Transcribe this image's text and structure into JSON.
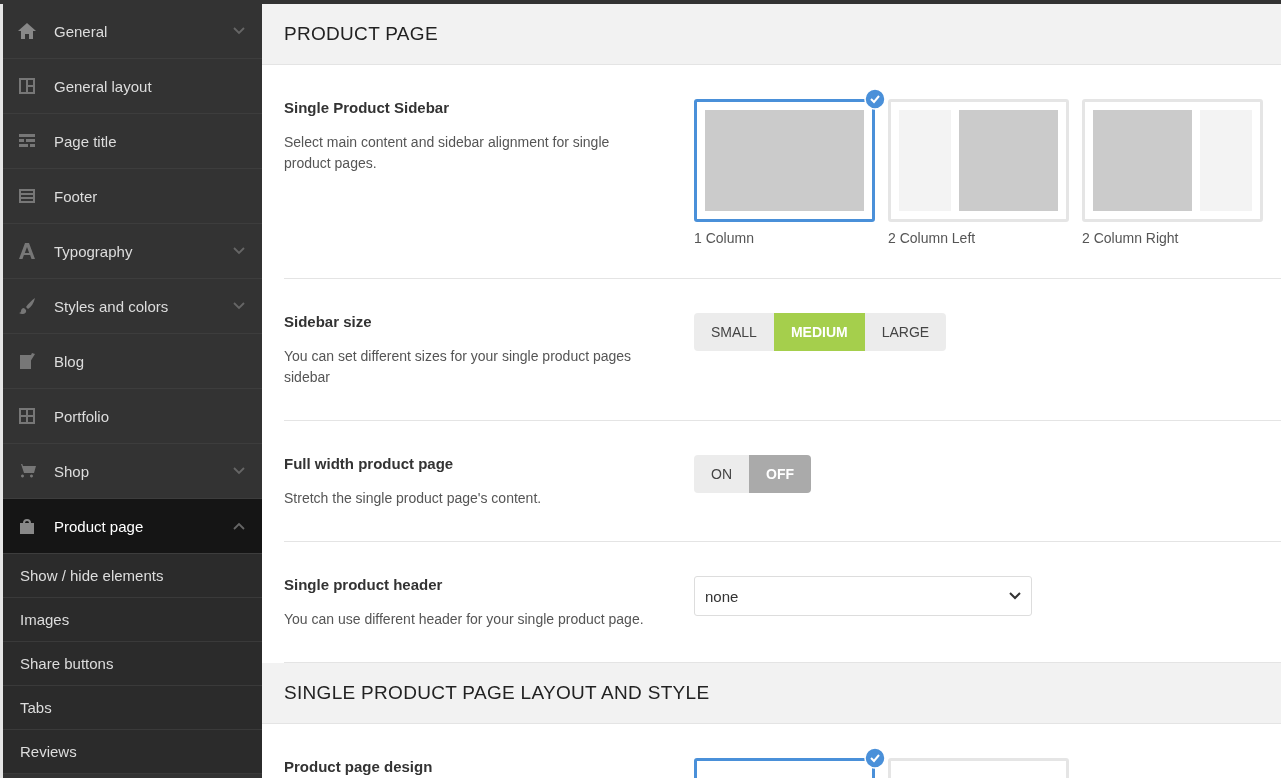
{
  "sidebar": {
    "items": [
      {
        "label": "General",
        "kind": "group",
        "expanded": false,
        "selected": false
      },
      {
        "label": "General layout",
        "kind": "link",
        "selected": false
      },
      {
        "label": "Page title",
        "kind": "link",
        "selected": false
      },
      {
        "label": "Footer",
        "kind": "link",
        "selected": false
      },
      {
        "label": "Typography",
        "kind": "group",
        "expanded": false,
        "selected": false
      },
      {
        "label": "Styles and colors",
        "kind": "group",
        "expanded": false,
        "selected": false
      },
      {
        "label": "Blog",
        "kind": "link",
        "selected": false
      },
      {
        "label": "Portfolio",
        "kind": "link",
        "selected": false
      },
      {
        "label": "Shop",
        "kind": "group",
        "expanded": false,
        "selected": false
      },
      {
        "label": "Product page",
        "kind": "group",
        "expanded": true,
        "selected": true,
        "children": [
          {
            "label": "Show / hide elements",
            "selected": false
          },
          {
            "label": "Images",
            "selected": false
          },
          {
            "label": "Share buttons",
            "selected": false
          },
          {
            "label": "Tabs",
            "selected": false
          },
          {
            "label": "Reviews",
            "selected": false
          }
        ]
      }
    ]
  },
  "sections": [
    {
      "title": "PRODUCT PAGE",
      "settings": [
        {
          "kind": "layout",
          "label": "Single Product Sidebar",
          "description": "Select main content and sidebar alignment for single product pages.",
          "options": [
            {
              "label": "1 Column",
              "kind": "full",
              "selected": true
            },
            {
              "label": "2 Column Left",
              "kind": "left",
              "selected": false
            },
            {
              "label": "2 Column Right",
              "kind": "right",
              "selected": false
            }
          ]
        },
        {
          "kind": "segmented",
          "label": "Sidebar size",
          "description": "You can set different sizes for your single product pages sidebar",
          "options": [
            {
              "label": "SMALL",
              "selected": false
            },
            {
              "label": "MEDIUM",
              "selected": true
            },
            {
              "label": "LARGE",
              "selected": false
            }
          ]
        },
        {
          "kind": "toggle",
          "label": "Full width product page",
          "description": "Stretch the single product page's content.",
          "options": [
            {
              "label": "ON",
              "selected": false
            },
            {
              "label": "OFF",
              "selected": true
            }
          ]
        },
        {
          "kind": "select",
          "label": "Single product header",
          "description": "You can use different header for your single product page.",
          "value": "none"
        }
      ]
    },
    {
      "title": "SINGLE PRODUCT PAGE LAYOUT AND STYLE",
      "settings": [
        {
          "kind": "layout",
          "label": "Product page design",
          "options": [
            {
              "kind": "blank",
              "selected": true
            },
            {
              "kind": "blank",
              "selected": false
            }
          ]
        }
      ]
    }
  ]
}
